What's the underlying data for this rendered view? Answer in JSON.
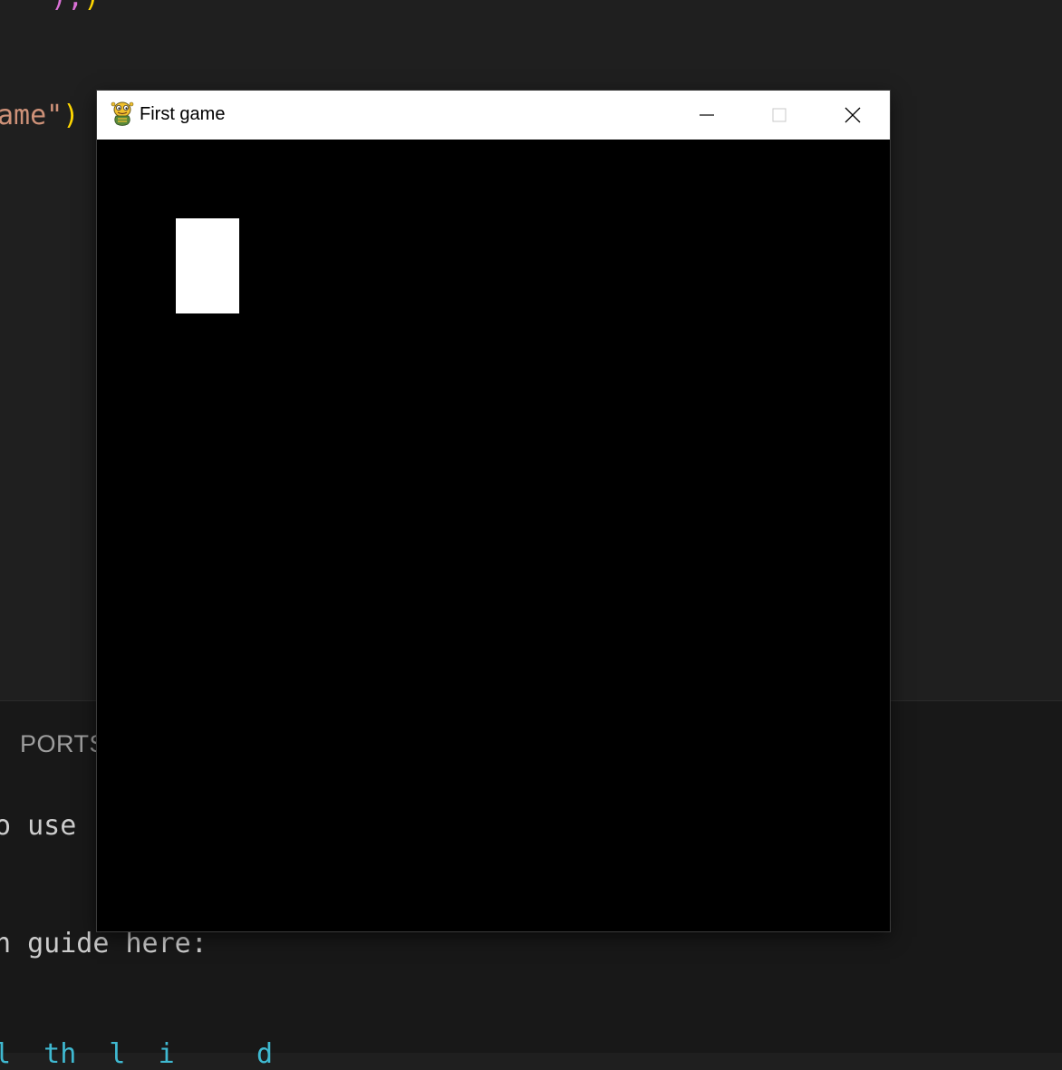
{
  "editor": {
    "line_top": {
      "part1": "\"),",
      "part2": ")"
    },
    "line_mid": {
      "string": "ame\"",
      "paren": ")"
    }
  },
  "panel": {
    "tab_label": "PORTS",
    "terminal_line_1": "o use",
    "terminal_line_2": "n guide here:",
    "terminal_line_3": "l  th  l  i     d  "
  },
  "window": {
    "title": "First game",
    "icon": "pygame-snake-icon",
    "minimize_icon": "minimize-icon",
    "maximize_icon": "maximize-icon",
    "close_icon": "close-icon",
    "background_color": "#000000",
    "player_color": "#ffffff"
  }
}
